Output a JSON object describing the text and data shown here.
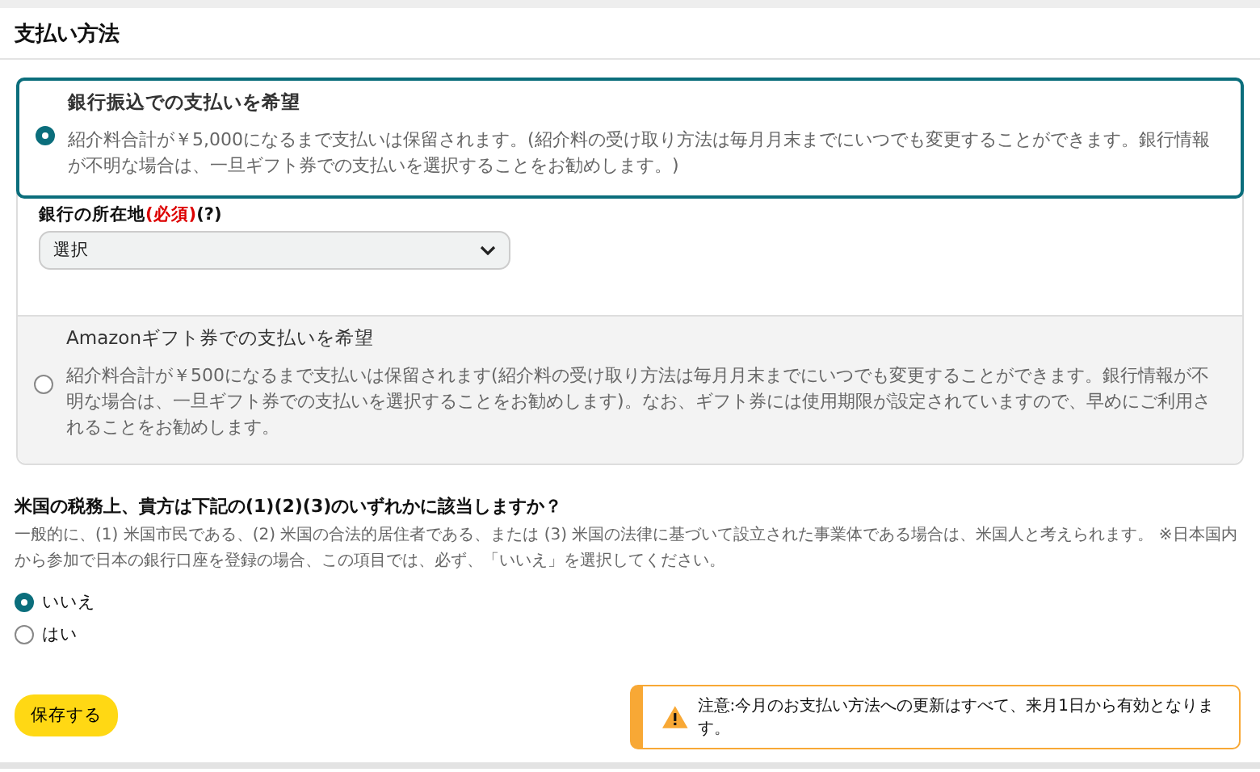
{
  "header": {
    "title": "支払い方法"
  },
  "payment_options": [
    {
      "kind": "bank",
      "selected": true,
      "title": "銀行振込での支払いを希望",
      "description": "紹介料合計が￥5,000になるまで支払いは保留されます。(紹介料の受け取り方法は毎月月末までにいつでも変更することができます。銀行情報が不明な場合は、一旦ギフト券での支払いを選択することをお勧めします。)",
      "field": {
        "label": "銀行の所在地",
        "required": "(必須)",
        "help": "(?)",
        "value": "選択"
      }
    },
    {
      "kind": "gift",
      "selected": false,
      "title": "Amazonギフト券での支払いを希望",
      "description": "紹介料合計が￥500になるまで支払いは保留されます(紹介料の受け取り方法は毎月月末までにいつでも変更することができます。銀行情報が不明な場合は、一旦ギフト券での支払いを選択することをお勧めします)。なお、ギフト券には使用期限が設定されていますので、早めにご利用されることをお勧めします。"
    }
  ],
  "tax_question": {
    "question": "米国の税務上、貴方は下記の(1)(2)(3)のいずれかに該当しますか？",
    "description": "一般的に、(1) 米国市民である、(2) 米国の合法的居住者である、または (3) 米国の法律に基づいて設立された事業体である場合は、米国人と考えられます。 ※日本国内から参加で日本の銀行口座を登録の場合、この項目では、必ず、「いいえ」を選択してください。",
    "options": [
      {
        "label": "いいえ",
        "selected": true
      },
      {
        "label": "はい",
        "selected": false
      }
    ]
  },
  "save_button": "保存する",
  "notice": "注意:今月のお支払い方法への更新はすべて、来月1日から有効となります。"
}
